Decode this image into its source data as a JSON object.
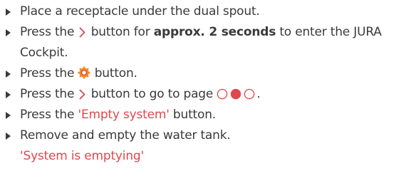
{
  "steps": [
    {
      "text": "Place a receptacle under the dual spout."
    },
    {
      "prefix": "Press the",
      "suffix_before_bold": "button for",
      "bold": "approx. 2 seconds",
      "suffix": "to enter the JURA Cockpit."
    },
    {
      "prefix": "Press the",
      "suffix": "button."
    },
    {
      "prefix": "Press the",
      "suffix": "button to go to page"
    },
    {
      "prefix": "Press the",
      "highlight": "'Empty system'",
      "suffix": "button."
    },
    {
      "text": "Remove and empty the water tank."
    }
  ],
  "result_text": "'System is emptying'",
  "icons": {
    "next": "chevron-right-icon",
    "settings": "gear-icon",
    "page_indicator": "page-dots-icon"
  },
  "colors": {
    "text": "#3a3a3a",
    "accent": "#e0474c",
    "gear_outer": "#f08a1e",
    "gear_inner": "#e0474c"
  }
}
